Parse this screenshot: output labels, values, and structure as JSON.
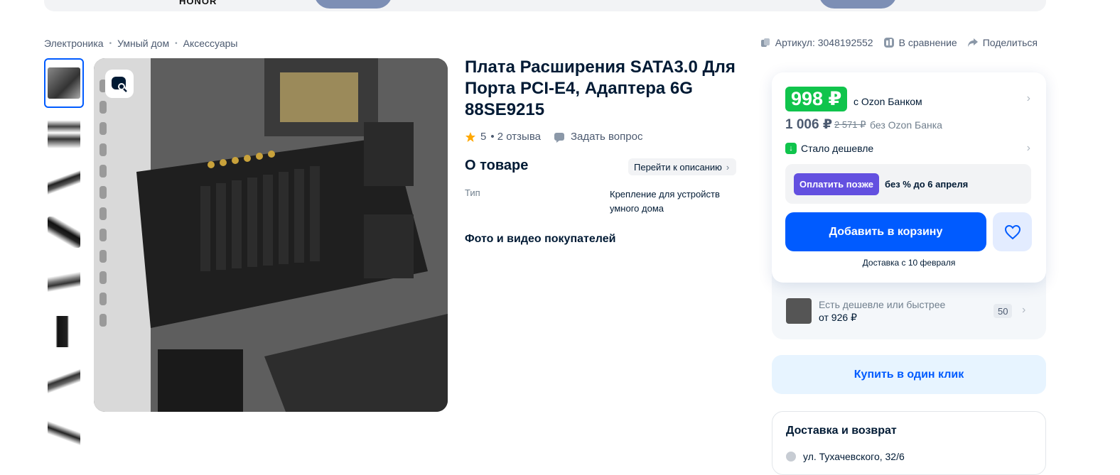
{
  "banner": {
    "brand": "HONOR"
  },
  "breadcrumbs": [
    "Электроника",
    "Умный дом",
    "Аксессуары"
  ],
  "breadcrumb_separator": "•",
  "top_actions": {
    "article": "Артикул: 3048192552",
    "compare": "В сравнение",
    "share": "Поделиться"
  },
  "product": {
    "title": "Плата Расширения SATA3.0 Для Порта PCI-E4, Адаптера 6G 88SE9215",
    "rating": "5",
    "reviews": "• 2 отзыва",
    "ask": "Задать вопрос"
  },
  "about": {
    "heading": "О товаре",
    "go_to_description": "Перейти к описанию",
    "prop_key": "Тип",
    "prop_value": "Крепление для устройств умного дома",
    "photos_heading": "Фото и видео покупателей"
  },
  "buybox": {
    "price_bank": "998 ₽",
    "with_bank": "с Ozon Банком",
    "price": "1 006 ₽",
    "old_price": "2 571 ₽",
    "without_bank": "без Ozon Банка",
    "cheaper": "Стало дешевле",
    "pay_later_button": "Оплатить позже",
    "pay_later_text": "без % до 6 апреля",
    "add_to_cart": "Добавить в корзину",
    "delivery_note": "Доставка с 10 февраля"
  },
  "alternatives": {
    "line1": "Есть дешевле или быстрее",
    "line2": "от 926 ₽",
    "count": "50"
  },
  "one_click": "Купить в один клик",
  "delivery_return": {
    "heading": "Доставка и возврат",
    "address": "ул. Тухачевского, 32/6"
  },
  "colors": {
    "accent": "#005bff",
    "bank_green": "#10c44c",
    "pay_later": "#6350e0"
  }
}
